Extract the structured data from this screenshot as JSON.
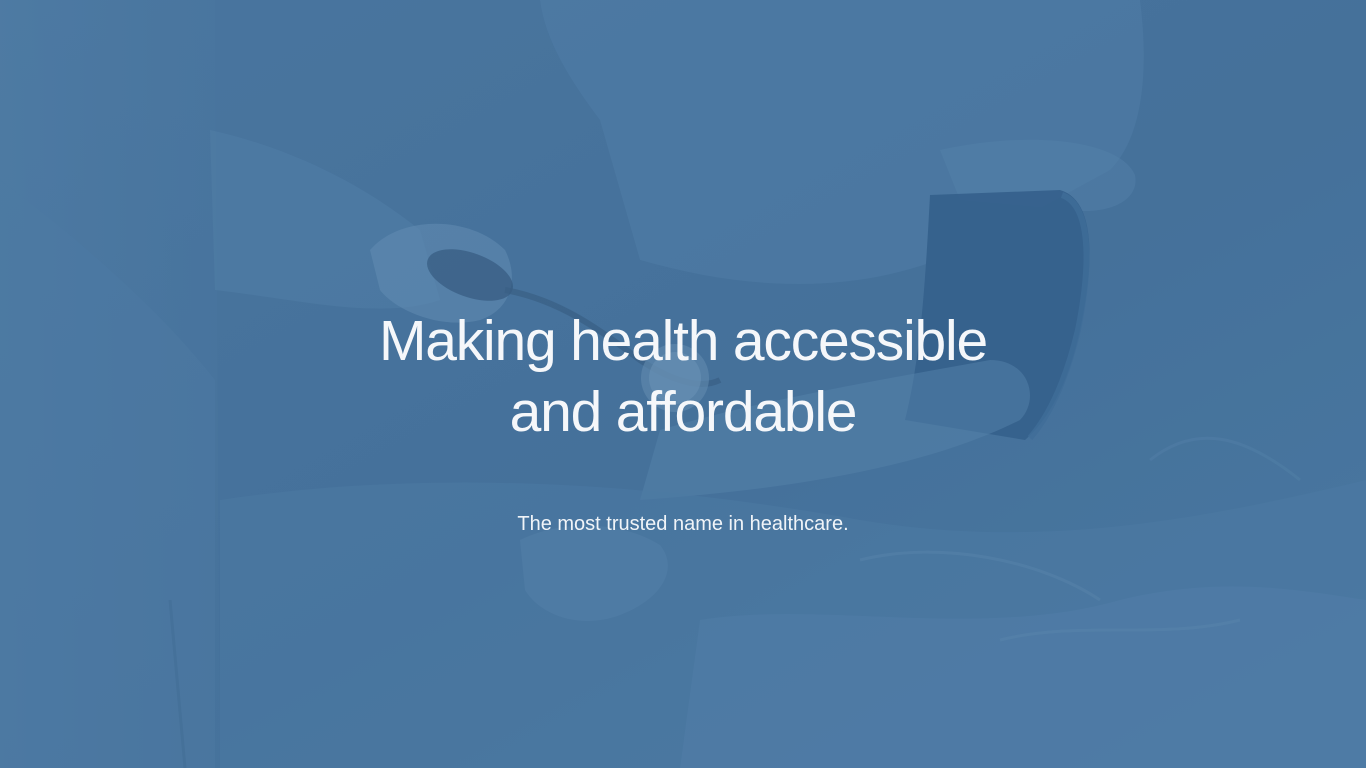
{
  "hero": {
    "background_image": "photo-doctor-measuring-blood-pressure",
    "overlay_color": "#46729a",
    "headline_line1": "Making health accessible",
    "headline_line2": "and affordable",
    "subtitle": "The most trusted name in healthcare."
  }
}
